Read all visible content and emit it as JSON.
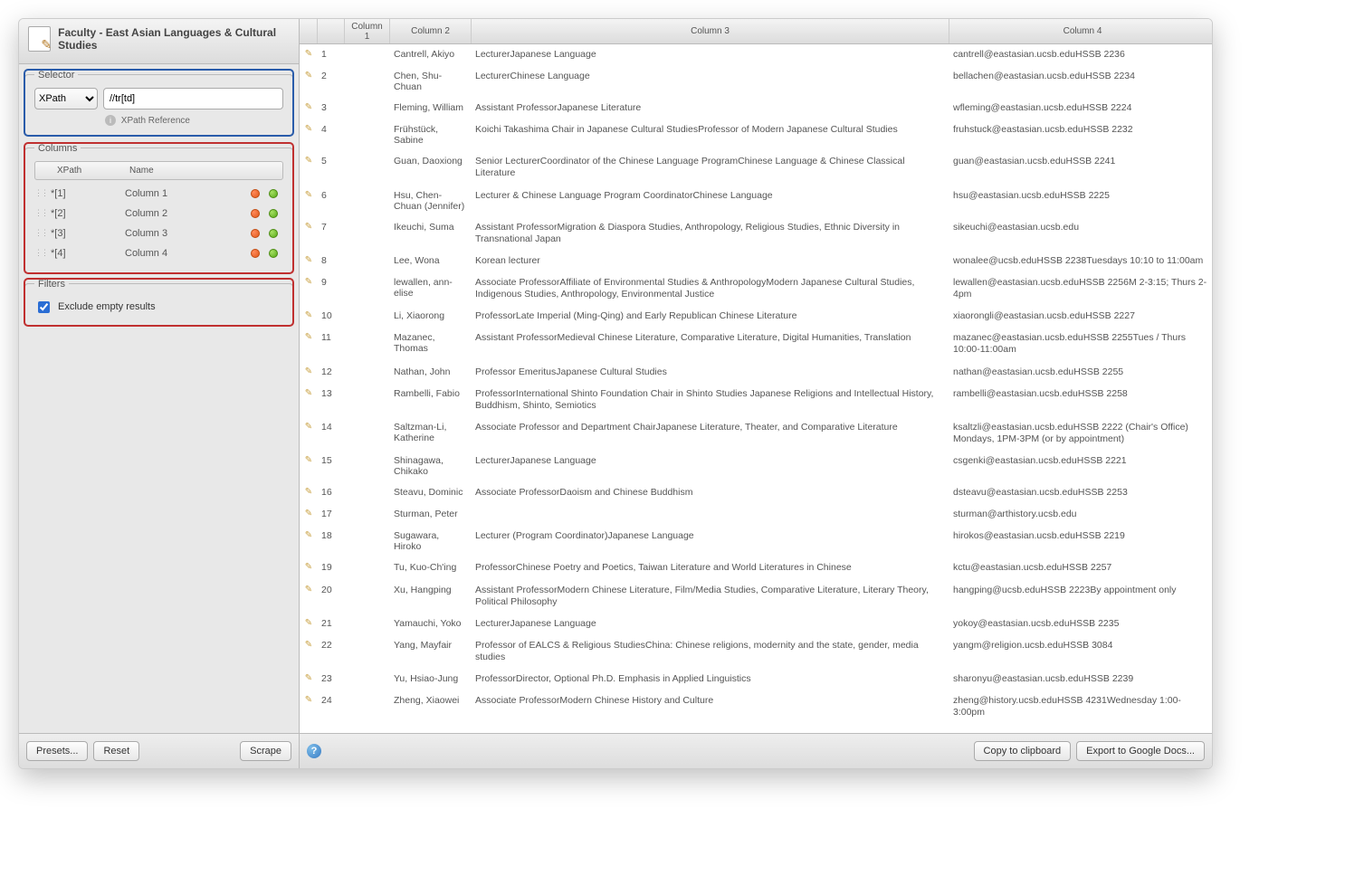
{
  "left": {
    "title": "Faculty - East Asian Languages & Cultural Studies",
    "selector": {
      "legend": "Selector",
      "type_options": [
        "XPath"
      ],
      "type_value": "XPath",
      "expr": "//tr[td]",
      "ref_label": "XPath Reference"
    },
    "columns": {
      "legend": "Columns",
      "head_xpath": "XPath",
      "head_name": "Name",
      "rows": [
        {
          "xpath": "*[1]",
          "name": "Column 1"
        },
        {
          "xpath": "*[2]",
          "name": "Column 2"
        },
        {
          "xpath": "*[3]",
          "name": "Column 3"
        },
        {
          "xpath": "*[4]",
          "name": "Column 4"
        }
      ]
    },
    "filters": {
      "legend": "Filters",
      "exclude_label": "Exclude empty results",
      "exclude_checked": true
    },
    "buttons": {
      "presets": "Presets...",
      "reset": "Reset",
      "scrape": "Scrape"
    }
  },
  "table": {
    "headers": {
      "c1": "Column 1",
      "c2": "Column 2",
      "c3": "Column 3",
      "c4": "Column 4"
    },
    "rows": [
      {
        "n": "1",
        "c2": "Cantrell, Akiyo",
        "c3": "LecturerJapanese Language",
        "c4": "cantrell@eastasian.ucsb.eduHSSB 2236"
      },
      {
        "n": "2",
        "c2": "Chen, Shu-Chuan",
        "c3": "LecturerChinese Language",
        "c4": "bellachen@eastasian.ucsb.eduHSSB 2234"
      },
      {
        "n": "3",
        "c2": "Fleming, William",
        "c3": "Assistant ProfessorJapanese Literature",
        "c4": "wfleming@eastasian.ucsb.eduHSSB 2224"
      },
      {
        "n": "4",
        "c2": "Frühstück, Sabine",
        "c3": "Koichi Takashima Chair in Japanese Cultural StudiesProfessor of Modern Japanese Cultural Studies",
        "c4": "fruhstuck@eastasian.ucsb.eduHSSB 2232"
      },
      {
        "n": "5",
        "c2": "Guan, Daoxiong",
        "c3": "Senior LecturerCoordinator of the Chinese Language ProgramChinese Language & Chinese Classical Literature",
        "c4": "guan@eastasian.ucsb.eduHSSB 2241"
      },
      {
        "n": "6",
        "c2": "Hsu, Chen-Chuan (Jennifer)",
        "c3": "Lecturer & Chinese Language Program CoordinatorChinese Language",
        "c4": "hsu@eastasian.ucsb.eduHSSB 2225"
      },
      {
        "n": "7",
        "c2": "Ikeuchi, Suma",
        "c3": "Assistant ProfessorMigration & Diaspora Studies, Anthropology, Religious Studies, Ethnic Diversity in Transnational Japan",
        "c4": "sikeuchi@eastasian.ucsb.edu"
      },
      {
        "n": "8",
        "c2": "Lee, Wona",
        "c3": "Korean lecturer",
        "c4": "wonalee@ucsb.eduHSSB 2238Tuesdays 10:10 to 11:00am"
      },
      {
        "n": "9",
        "c2": "lewallen, ann-elise",
        "c3": "Associate ProfessorAffiliate of Environmental Studies & AnthropologyModern Japanese Cultural Studies, Indigenous Studies, Anthropology, Environmental Justice",
        "c4": "lewallen@eastasian.ucsb.eduHSSB 2256M 2-3:15; Thurs 2-4pm"
      },
      {
        "n": "10",
        "c2": "Li, Xiaorong",
        "c3": "ProfessorLate Imperial (Ming-Qing) and Early Republican Chinese Literature",
        "c4": "xiaorongli@eastasian.ucsb.eduHSSB 2227"
      },
      {
        "n": "11",
        "c2": "Mazanec, Thomas",
        "c3": "Assistant ProfessorMedieval Chinese Literature, Comparative Literature, Digital Humanities, Translation",
        "c4": "mazanec@eastasian.ucsb.eduHSSB 2255Tues / Thurs 10:00-11:00am"
      },
      {
        "n": "12",
        "c2": "Nathan, John",
        "c3": "Professor EmeritusJapanese Cultural Studies",
        "c4": "nathan@eastasian.ucsb.eduHSSB 2255"
      },
      {
        "n": "13",
        "c2": "Rambelli, Fabio",
        "c3": "ProfessorInternational Shinto Foundation Chair in Shinto Studies Japanese Religions and Intellectual History, Buddhism, Shinto, Semiotics",
        "c4": "rambelli@eastasian.ucsb.eduHSSB 2258"
      },
      {
        "n": "14",
        "c2": "Saltzman-Li, Katherine",
        "c3": "Associate Professor and Department ChairJapanese Literature, Theater, and Comparative Literature",
        "c4": "ksaltzli@eastasian.ucsb.eduHSSB 2222 (Chair's Office) Mondays, 1PM-3PM (or by appointment)"
      },
      {
        "n": "15",
        "c2": "Shinagawa, Chikako",
        "c3": "LecturerJapanese Language",
        "c4": "csgenki@eastasian.ucsb.eduHSSB 2221"
      },
      {
        "n": "16",
        "c2": "Steavu, Dominic",
        "c3": "Associate ProfessorDaoism and Chinese Buddhism",
        "c4": "dsteavu@eastasian.ucsb.eduHSSB 2253"
      },
      {
        "n": "17",
        "c2": "Sturman, Peter",
        "c3": "",
        "c4": "sturman@arthistory.ucsb.edu"
      },
      {
        "n": "18",
        "c2": "Sugawara, Hiroko",
        "c3": "Lecturer (Program Coordinator)Japanese Language",
        "c4": "hirokos@eastasian.ucsb.eduHSSB 2219"
      },
      {
        "n": "19",
        "c2": "Tu, Kuo-Ch'ing",
        "c3": "ProfessorChinese Poetry and Poetics, Taiwan Literature and World Literatures in Chinese",
        "c4": "kctu@eastasian.ucsb.eduHSSB 2257"
      },
      {
        "n": "20",
        "c2": "Xu, Hangping",
        "c3": "Assistant ProfessorModern Chinese Literature, Film/Media Studies, Comparative Literature, Literary Theory, Political Philosophy",
        "c4": "hangping@ucsb.eduHSSB 2223By appointment only"
      },
      {
        "n": "21",
        "c2": "Yamauchi, Yoko",
        "c3": "LecturerJapanese Language",
        "c4": "yokoy@eastasian.ucsb.eduHSSB 2235"
      },
      {
        "n": "22",
        "c2": "Yang, Mayfair",
        "c3": "Professor of EALCS & Religious StudiesChina: Chinese religions, modernity and the state, gender, media studies",
        "c4": "yangm@religion.ucsb.eduHSSB 3084"
      },
      {
        "n": "23",
        "c2": "Yu, Hsiao-Jung",
        "c3": "ProfessorDirector, Optional Ph.D. Emphasis in Applied Linguistics",
        "c4": "sharonyu@eastasian.ucsb.eduHSSB 2239"
      },
      {
        "n": "24",
        "c2": "Zheng, Xiaowei",
        "c3": "Associate ProfessorModern Chinese History and Culture",
        "c4": "zheng@history.ucsb.eduHSSB 4231Wednesday 1:00-3:00pm"
      }
    ]
  },
  "right_buttons": {
    "copy": "Copy to clipboard",
    "export": "Export to Google Docs..."
  }
}
